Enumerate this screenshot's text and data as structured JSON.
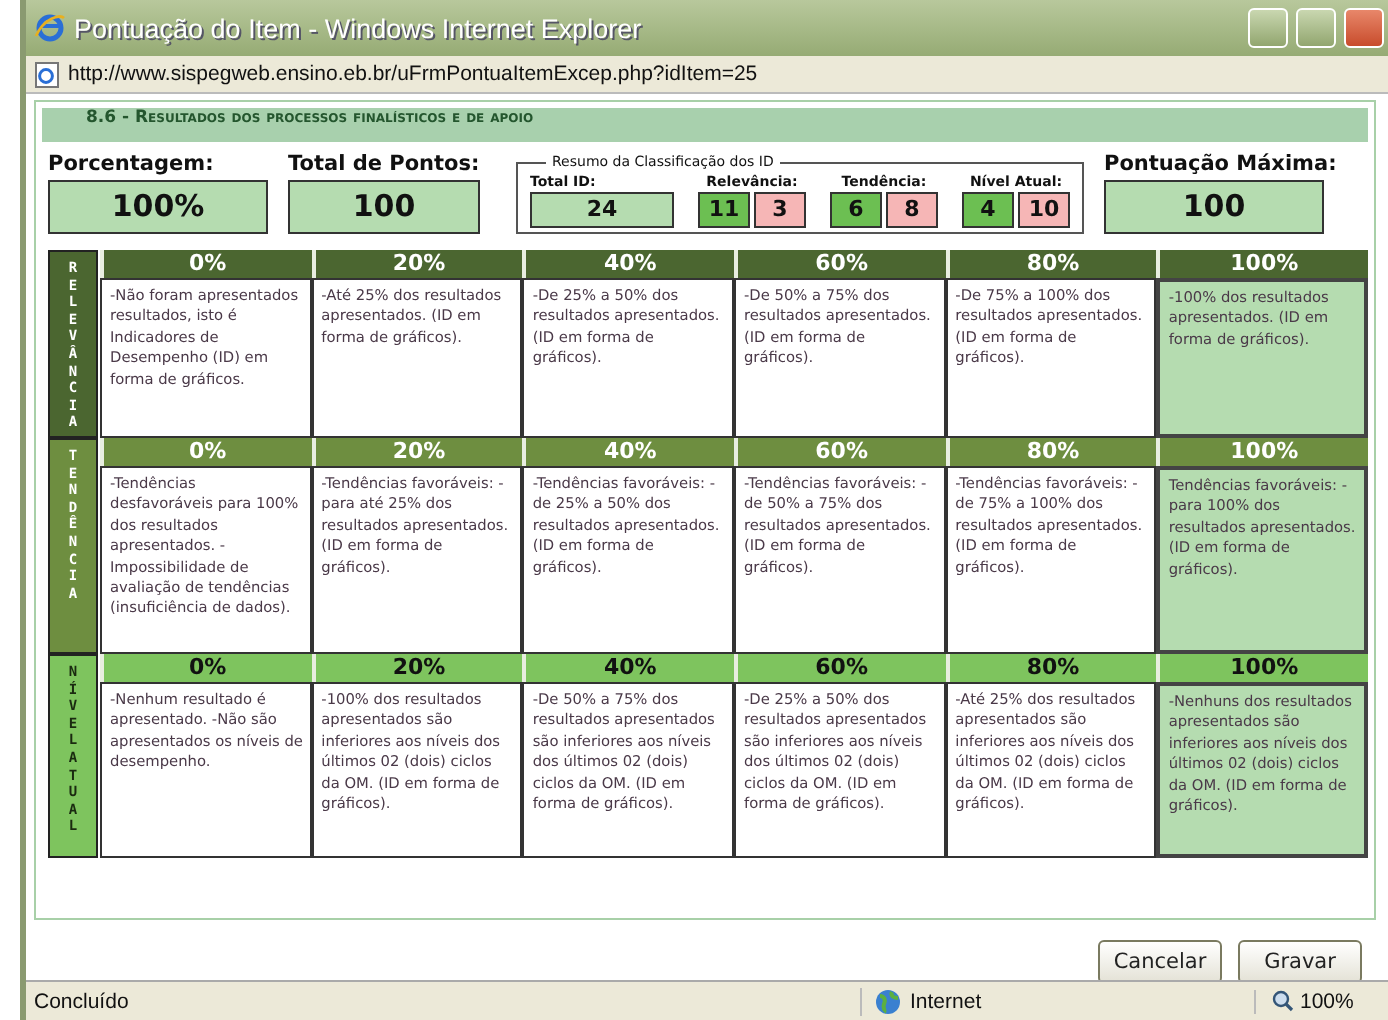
{
  "window": {
    "title": "Pontuação do Item - Windows Internet Explorer"
  },
  "address_bar": {
    "url": "http://www.sispegweb.ensino.eb.br/uFrmPontuaItemExcep.php?idItem=25"
  },
  "section_title": "8.6 - Resultados dos processos finalísticos e de apoio",
  "summary": {
    "percentage": {
      "label": "Porcentagem:",
      "value": "100%"
    },
    "total_points": {
      "label": "Total de Pontos:",
      "value": "100"
    },
    "classification": {
      "legend": "Resumo da Classificação dos ID",
      "total": {
        "label": "Total ID:",
        "value": "24"
      },
      "groups": [
        {
          "label": "Relevância:",
          "favorable": "11",
          "unfavorable": "3"
        },
        {
          "label": "Tendência:",
          "favorable": "6",
          "unfavorable": "8"
        },
        {
          "label": "Nível Atual:",
          "favorable": "4",
          "unfavorable": "10"
        }
      ]
    },
    "max_points": {
      "label": "Pontuação Máxima:",
      "value": "100"
    }
  },
  "criteria": [
    {
      "name": "RELEVÂNCIA",
      "kind": "dark",
      "columns": [
        {
          "percent": "0%",
          "text": "-Não foram apresentados resultados, isto é Indicadores de Desempenho (ID) em forma de gráficos.",
          "selected": false
        },
        {
          "percent": "20%",
          "text": "-Até 25% dos resultados apresentados. (ID em forma de gráficos).",
          "selected": false
        },
        {
          "percent": "40%",
          "text": "-De 25% a 50% dos resultados apresentados. (ID em forma de gráficos).",
          "selected": false
        },
        {
          "percent": "60%",
          "text": "-De 50% a 75% dos resultados apresentados. (ID em forma de gráficos).",
          "selected": false
        },
        {
          "percent": "80%",
          "text": "-De 75% a 100% dos resultados apresentados. (ID em forma de gráficos).",
          "selected": false
        },
        {
          "percent": "100%",
          "text": "-100% dos resultados apresentados. (ID em forma de gráficos).",
          "selected": true
        }
      ]
    },
    {
      "name": "TENDÊNCIA",
      "kind": "medium",
      "columns": [
        {
          "percent": "0%",
          "text": "-Tendências desfavoráveis para 100% dos resultados apresentados. -Impossibilidade de avaliação de tendências (insuficiência de dados).",
          "selected": false
        },
        {
          "percent": "20%",
          "text": "-Tendências favoráveis: -para até 25% dos resultados apresentados. (ID em forma de gráficos).",
          "selected": false
        },
        {
          "percent": "40%",
          "text": "-Tendências favoráveis: -de 25% a 50% dos resultados apresentados. (ID em forma de gráficos).",
          "selected": false
        },
        {
          "percent": "60%",
          "text": "-Tendências favoráveis: -de 50% a 75% dos resultados apresentados. (ID em forma de gráficos).",
          "selected": false
        },
        {
          "percent": "80%",
          "text": "-Tendências favoráveis: -de 75% a 100% dos resultados apresentados. (ID em forma de gráficos).",
          "selected": false
        },
        {
          "percent": "100%",
          "text": "Tendências favoráveis: -para 100% dos resultados apresentados. (ID em forma de gráficos).",
          "selected": true
        }
      ]
    },
    {
      "name": "NÍVEL ATUAL",
      "kind": "light",
      "columns": [
        {
          "percent": "0%",
          "text": "-Nenhum resultado é apresentado. -Não são apresentados os níveis de desempenho.",
          "selected": false
        },
        {
          "percent": "20%",
          "text": "-100% dos resultados apresentados são inferiores aos níveis dos últimos 02 (dois) ciclos da OM. (ID em forma de gráficos).",
          "selected": false
        },
        {
          "percent": "40%",
          "text": "-De 50% a 75% dos resultados apresentados são inferiores aos níveis dos últimos 02 (dois) ciclos da OM. (ID em forma de gráficos).",
          "selected": false
        },
        {
          "percent": "60%",
          "text": "-De 25% a 50% dos resultados apresentados são inferiores aos níveis dos últimos 02 (dois) ciclos da OM. (ID em forma de gráficos).",
          "selected": false
        },
        {
          "percent": "80%",
          "text": "-Até 25% dos resultados apresentados são inferiores aos níveis dos últimos 02 (dois) ciclos da OM. (ID em forma de gráficos).",
          "selected": false
        },
        {
          "percent": "100%",
          "text": "-Nenhuns dos resultados apresentados são inferiores aos níveis dos últimos 02 (dois) ciclos da OM. (ID em forma de gráficos).",
          "selected": true
        }
      ]
    }
  ],
  "buttons": [
    "Cancelar",
    "Gravar"
  ],
  "status_bar": {
    "text": "Concluído",
    "zone": "Internet",
    "zoom": "100%"
  }
}
